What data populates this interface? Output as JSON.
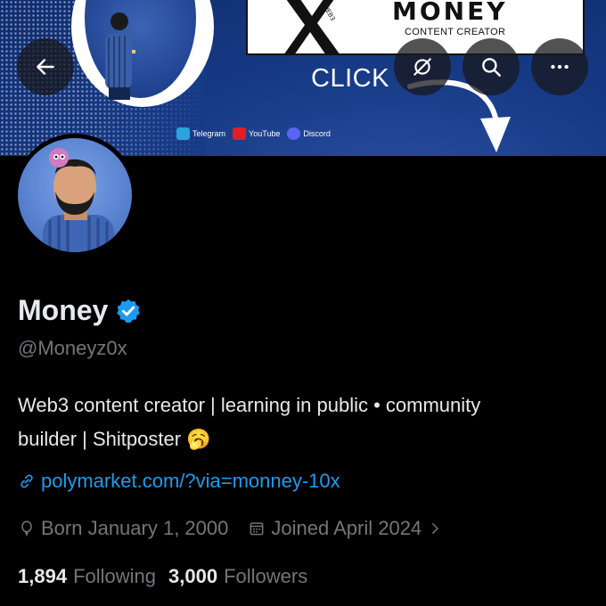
{
  "banner": {
    "card_title": "MONEY",
    "card_subtitle": "CONTENT CREATOR",
    "card_x_caption": "WEB3",
    "click_text": "CLICK",
    "socials": [
      "Telegram",
      "YouTube",
      "Discord"
    ],
    "colors": {
      "background": "#173a86",
      "telegram": "#2aa3df",
      "youtube": "#e21d27",
      "discord": "#5865f2"
    }
  },
  "nav": {
    "back_icon": "arrow-left-icon",
    "grok_icon": "grok-icon",
    "search_icon": "search-icon",
    "more_icon": "more-icon"
  },
  "profile": {
    "name": "Money",
    "handle": "@Moneyz0x",
    "bio_line1": "Web3 content creator | learning in public • community",
    "bio_line2": "builder | Shitposter 🥱",
    "link": "polymarket.com/?via=monney-10x",
    "born": "Born January 1, 2000",
    "joined": "Joined April 2024",
    "following_count": "1,894",
    "following_label": "Following",
    "followers_count": "3,000",
    "followers_label": "Followers",
    "colors": {
      "accent": "#1d9bf0",
      "muted": "#71767b",
      "text": "#e7e9ea"
    }
  }
}
